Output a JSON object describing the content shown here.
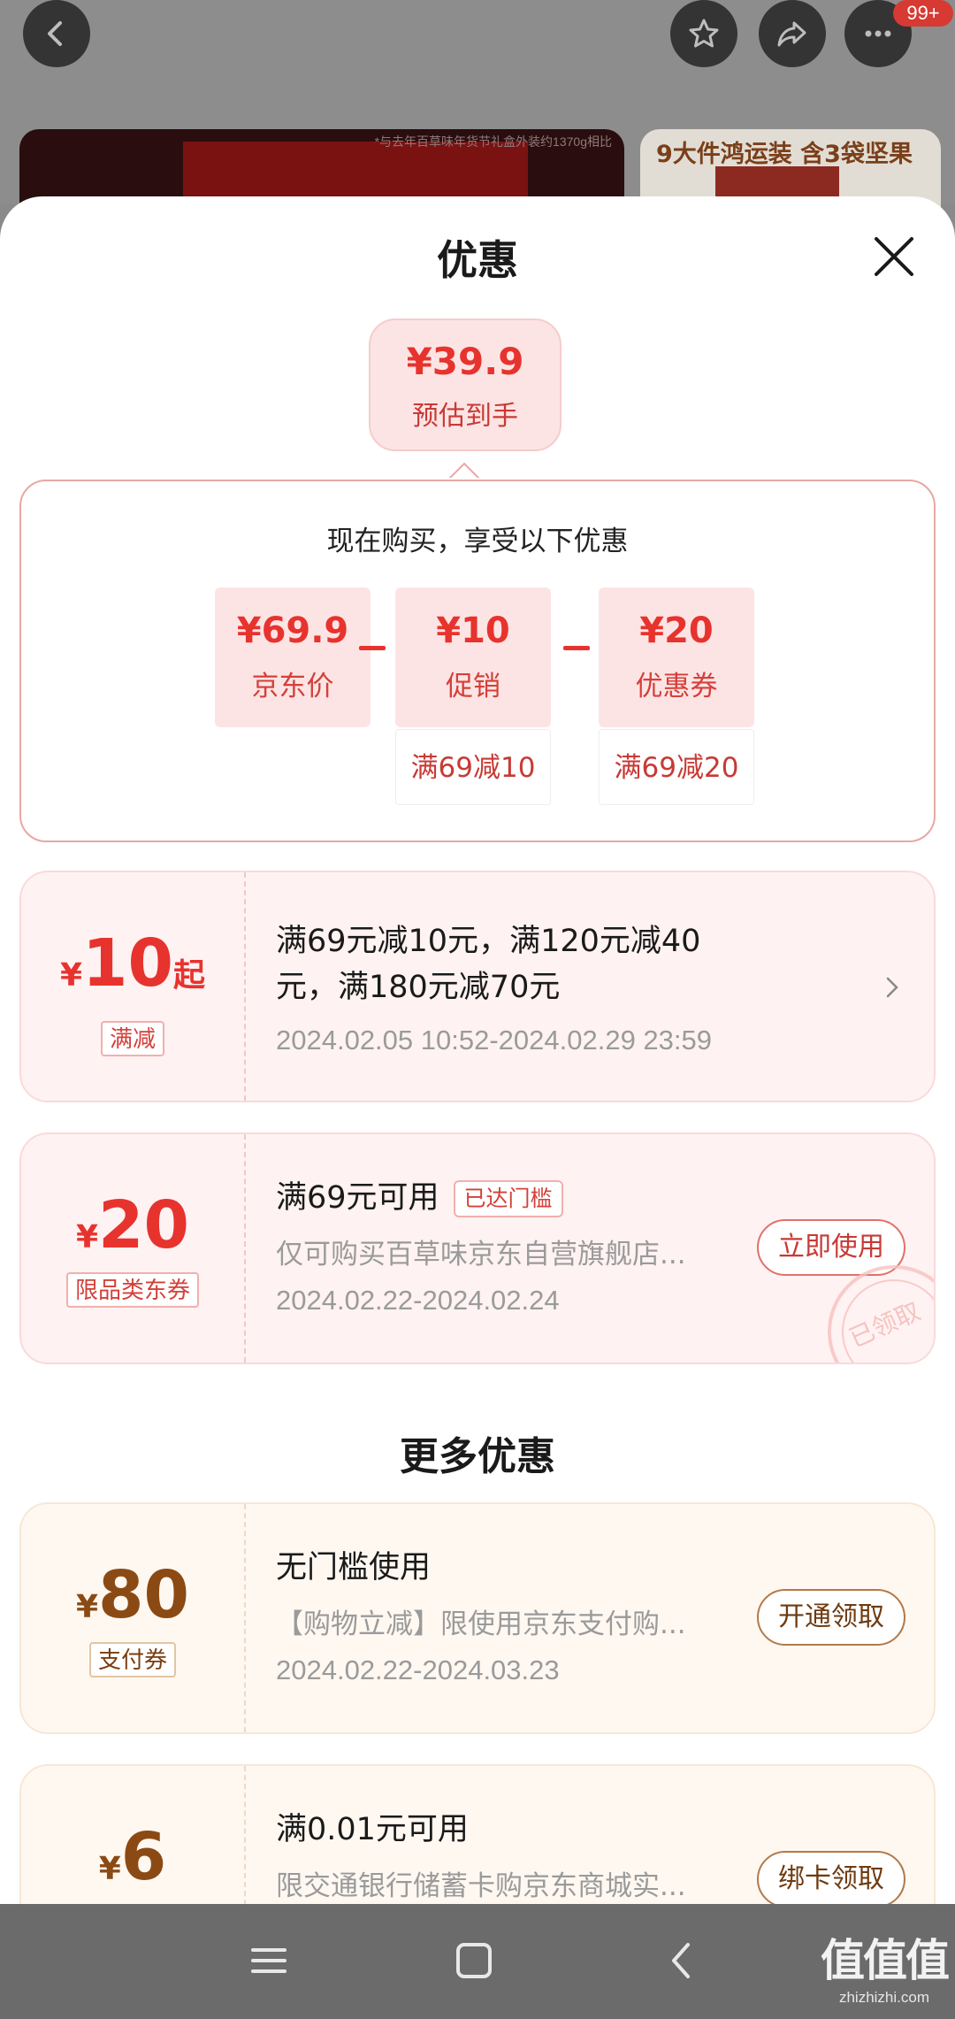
{
  "header": {
    "notification_badge": "99+",
    "background_banner_note": "*与去年百草味年货节礼盒外装约1370g相比",
    "background_banner_right_title": "9大件鸿运装 含3袋坚果"
  },
  "sheet": {
    "title": "优惠",
    "estimate": {
      "price": "¥39.9",
      "label": "预估到手"
    },
    "calc": {
      "heading": "现在购买，享受以下优惠",
      "items": [
        {
          "value": "¥69.9",
          "label": "京东价",
          "sub": ""
        },
        {
          "value": "¥10",
          "label": "促销",
          "sub": "满69减10"
        },
        {
          "value": "¥20",
          "label": "优惠券",
          "sub": "满69减20"
        }
      ]
    },
    "coupons": [
      {
        "yen": "¥",
        "amount": "10",
        "suffix": "起",
        "tag": "满减",
        "line1": "满69元减10元，满120元减40",
        "line2": "元，满180元减70元",
        "date": "2024.02.05 10:52-2024.02.29 23:59"
      },
      {
        "yen": "¥",
        "amount": "20",
        "tag": "限品类东券",
        "title": "满69元可用",
        "reached": "已达门槛",
        "desc": "仅可购买百草味京东自营旗舰店...",
        "date": "2024.02.22-2024.02.24",
        "button": "立即使用",
        "stamp": "已领取"
      }
    ],
    "more_title": "更多优惠",
    "more_coupons": [
      {
        "yen": "¥",
        "amount": "80",
        "tag": "支付券",
        "title": "无门槛使用",
        "desc": "【购物立减】限使用京东支付购...",
        "date": "2024.02.22-2024.03.23",
        "button": "开通领取"
      },
      {
        "yen": "¥",
        "amount": "6",
        "title": "满0.01元可用",
        "desc": "限交通银行储蓄卡购京东商城实...",
        "button": "绑卡领取"
      }
    ]
  },
  "watermark": {
    "glyphs": "值值值",
    "site": "zhizhizhi.com"
  },
  "icons": [
    "back-icon",
    "star-icon",
    "share-icon",
    "more-icon",
    "close-icon",
    "chevron-right-icon",
    "menu-icon",
    "home-icon",
    "nav-back-icon"
  ]
}
